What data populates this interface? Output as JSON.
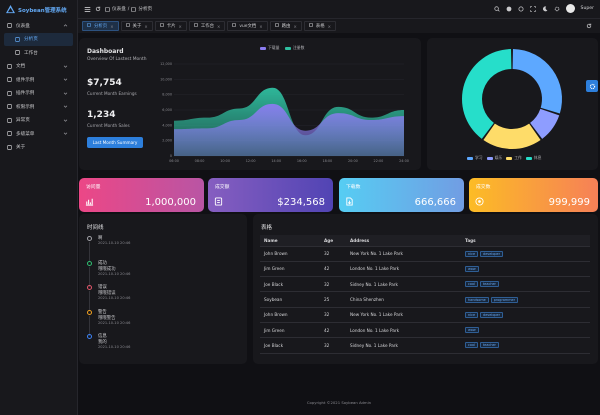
{
  "app": {
    "logo_text": "Soybean管理系统",
    "brand_color": "#63a9f4"
  },
  "sidebar": {
    "items": [
      {
        "label": "仪表盘",
        "icon": "dashboard-icon",
        "expanded": true
      },
      {
        "label": "分析页",
        "icon": "analysis-icon",
        "active": true,
        "sub": true
      },
      {
        "label": "工作台",
        "icon": "workbench-icon",
        "sub": true
      },
      {
        "label": "文档",
        "icon": "document-icon"
      },
      {
        "label": "组件示例",
        "icon": "component-icon"
      },
      {
        "label": "插件示例",
        "icon": "plugin-icon"
      },
      {
        "label": "权限示例",
        "icon": "permission-icon"
      },
      {
        "label": "异常页",
        "icon": "exception-icon"
      },
      {
        "label": "多级菜单",
        "icon": "multi-menu-icon"
      },
      {
        "label": "关于",
        "icon": "about-icon"
      }
    ]
  },
  "header": {
    "breadcrumb": [
      {
        "label": "仪表盘"
      },
      {
        "label": "分析页"
      }
    ],
    "user_name": "Super"
  },
  "tabs": [
    {
      "label": "分析页",
      "active": true
    },
    {
      "label": "关于"
    },
    {
      "label": "卡片"
    },
    {
      "label": "工作台"
    },
    {
      "label": "vue文档"
    },
    {
      "label": "路由"
    },
    {
      "label": "表格"
    }
  ],
  "dashboard": {
    "title": "Dashboard",
    "subtitle": "Overview Of Lastest Month",
    "earnings_value": "$7,754",
    "earnings_label": "Current Month Earnings",
    "sales_value": "1,234",
    "sales_label": "Current Month Sales",
    "summary_button": "Last Month Summary"
  },
  "chart_data": [
    {
      "type": "area",
      "series": [
        {
          "name": "下载量",
          "color": "#8b7cf0",
          "values": [
            3500,
            3600,
            4700,
            6800,
            3300,
            5600,
            4700,
            5200
          ]
        },
        {
          "name": "注册数",
          "color": "#2fbfa0",
          "values": [
            4600,
            5000,
            6200,
            8900,
            2700,
            6400,
            5000,
            6000
          ]
        }
      ],
      "x": [
        "06:00",
        "08:00",
        "10:00",
        "12:00",
        "14:00",
        "16:00",
        "18:00",
        "20:00",
        "22:00",
        "24:00"
      ],
      "y_ticks": [
        "0",
        "2,000",
        "4,000",
        "6,000",
        "8,000",
        "10,000",
        "12,000"
      ],
      "ylim": [
        0,
        12000
      ],
      "legend_position": "top"
    },
    {
      "type": "pie",
      "donut": true,
      "categories": [
        "学习",
        "娱乐",
        "工作",
        "休息"
      ],
      "values": [
        30,
        10,
        20,
        40
      ],
      "colors": [
        "#5da8ff",
        "#8e9dff",
        "#fedc69",
        "#26deca"
      ],
      "legend_position": "bottom"
    }
  ],
  "stats": [
    {
      "title": "访问量",
      "value": "1,000,000",
      "icon": "chart-icon",
      "from": "#ec4786",
      "to": "#b955a4"
    },
    {
      "title": "成交额",
      "value": "$234,568",
      "icon": "money-icon",
      "from": "#865ec0",
      "to": "#5144b4"
    },
    {
      "title": "下载数",
      "value": "666,666",
      "icon": "download-icon",
      "from": "#56cdf3",
      "to": "#719de3"
    },
    {
      "title": "成交数",
      "value": "999,999",
      "icon": "trade-icon",
      "from": "#fcbc25",
      "to": "#f68057"
    }
  ],
  "timeline": {
    "title": "时间线",
    "items": [
      {
        "label": "啊",
        "desc": "",
        "time": "2021-10-10 20:46",
        "color": "#a0a0a6"
      },
      {
        "label": "成功",
        "desc": "哦哦成功",
        "time": "2021-10-10 20:46",
        "color": "#2fbf71"
      },
      {
        "label": "错误",
        "desc": "哦哦错误",
        "time": "2021-10-10 20:46",
        "color": "#e2556a"
      },
      {
        "label": "警告",
        "desc": "哦哦警告",
        "time": "2021-10-10 20:46",
        "color": "#f0a020"
      },
      {
        "label": "信息",
        "desc": "我的",
        "time": "2021-10-10 20:46",
        "color": "#3b82f6"
      }
    ]
  },
  "table": {
    "title": "表格",
    "columns": [
      "Name",
      "Age",
      "Address",
      "Tags"
    ],
    "rows": [
      {
        "name": "John Brown",
        "age": "32",
        "address": "New York No. 1 Lake Park",
        "tags": [
          "nice",
          "developer"
        ]
      },
      {
        "name": "Jim Green",
        "age": "42",
        "address": "London No. 1 Lake Park",
        "tags": [
          "wow"
        ]
      },
      {
        "name": "Joe Black",
        "age": "32",
        "address": "Sidney No. 1 Lake Park",
        "tags": [
          "cool",
          "teacher"
        ]
      },
      {
        "name": "Soybean",
        "age": "25",
        "address": "China Shenzhen",
        "tags": [
          "handsome",
          "programmer"
        ]
      },
      {
        "name": "John Brown",
        "age": "32",
        "address": "New York No. 1 Lake Park",
        "tags": [
          "nice",
          "developer"
        ]
      },
      {
        "name": "Jim Green",
        "age": "42",
        "address": "London No. 1 Lake Park",
        "tags": [
          "wow"
        ]
      },
      {
        "name": "Joe Black",
        "age": "32",
        "address": "Sidney No. 1 Lake Park",
        "tags": [
          "cool",
          "teacher"
        ]
      }
    ]
  },
  "footer": {
    "text": "Copyright ©2021 Soybean Admin"
  }
}
